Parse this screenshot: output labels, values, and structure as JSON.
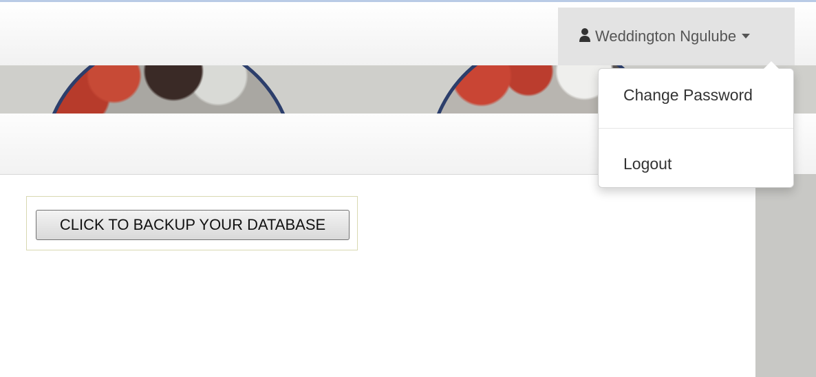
{
  "navbar": {
    "user_name": "Weddington Ngulube"
  },
  "dropdown": {
    "items": [
      {
        "label": "Change Password"
      },
      {
        "label": "Logout"
      }
    ]
  },
  "main": {
    "backup_button_label": "CLICK TO BACKUP YOUR DATABASE"
  },
  "icons": {
    "user": "user-icon",
    "caret": "caret-down-icon"
  },
  "colors": {
    "menu_background": "#e3e3e3",
    "text": "#555555",
    "banner_circle_border": "#2c3e6b"
  }
}
